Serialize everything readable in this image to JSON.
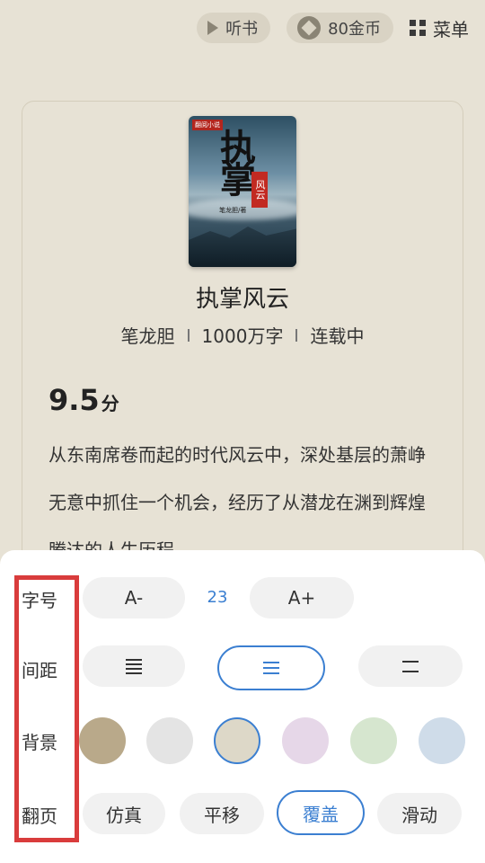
{
  "topbar": {
    "listen_label": "听书",
    "coins_label": "80金币",
    "menu_label": "菜单"
  },
  "book": {
    "cover_badge": "翻阅小说",
    "cover_title_big": "执掌",
    "cover_title_seal": "风云",
    "cover_author": "笔龙胆/著",
    "title": "执掌风云",
    "author": "笔龙胆",
    "word_count": "1000万字",
    "status": "连载中",
    "score": "9.5",
    "score_unit": "分",
    "intro": "从东南席卷而起的时代风云中，深处基层的萧峥无意中抓住一个机会，经历了从潜龙在渊到辉煌腾达的人生历程"
  },
  "settings": {
    "font_size": {
      "label": "字号",
      "decrease": "A-",
      "value": "23",
      "increase": "A+"
    },
    "spacing": {
      "label": "间距",
      "options": [
        "compact",
        "normal",
        "wide"
      ],
      "selected": "normal"
    },
    "background": {
      "label": "背景",
      "colors": [
        "#b9a98a",
        "#e4e4e4",
        "#ddd8c8",
        "#e6d7e8",
        "#d6e6cf",
        "#cfdce9"
      ],
      "selected_index": 2
    },
    "page_turn": {
      "label": "翻页",
      "options": [
        "仿真",
        "平移",
        "覆盖",
        "滑动"
      ],
      "selected": "覆盖"
    }
  },
  "colors": {
    "accent": "#3b7fd1",
    "highlight_box": "#d93c3c",
    "page_bg": "#e7e2d5"
  }
}
